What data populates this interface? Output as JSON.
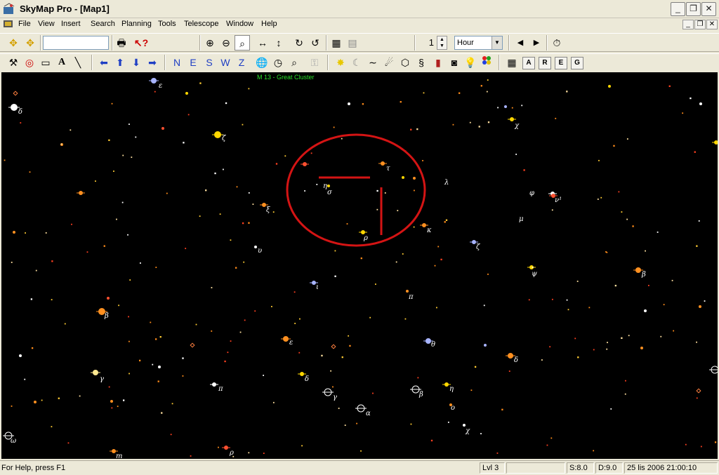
{
  "window": {
    "title": "SkyMap Pro - [Map1]",
    "controls": [
      "_",
      "❐",
      "✕"
    ]
  },
  "menu": [
    "File",
    "View",
    "Insert",
    "Search",
    "Planning",
    "Tools",
    "Telescope",
    "Window",
    "Help"
  ],
  "mdi_controls": [
    "_",
    "❐",
    "✕"
  ],
  "toolbar": {
    "search_value": "",
    "step_value": "1",
    "unit_select": "Hour",
    "direction_labels": [
      "N",
      "E",
      "S",
      "W",
      "Z"
    ],
    "grid_buttons": [
      "A",
      "R",
      "E",
      "G"
    ]
  },
  "map": {
    "object_label": "M 13 - Great Cluster",
    "colors": {
      "background": "#000000",
      "circle": "#d41414",
      "label": "#28e028"
    },
    "star_labels": [
      {
        "text": "ε"
      },
      {
        "text": "δ"
      },
      {
        "text": "ζ"
      },
      {
        "text": "χ"
      },
      {
        "text": "τ"
      },
      {
        "text": "η"
      },
      {
        "text": "σ"
      },
      {
        "text": "λ"
      },
      {
        "text": "φ"
      },
      {
        "text": "ν¹"
      },
      {
        "text": "ξ"
      },
      {
        "text": "μ"
      },
      {
        "text": "κ"
      },
      {
        "text": "ρ"
      },
      {
        "text": "υ"
      },
      {
        "text": "ζ"
      },
      {
        "text": "ψ"
      },
      {
        "text": "β"
      },
      {
        "text": "ι"
      },
      {
        "text": "π"
      },
      {
        "text": "β"
      },
      {
        "text": "ε"
      },
      {
        "text": "θ"
      },
      {
        "text": "δ"
      },
      {
        "text": "γ"
      },
      {
        "text": "δ"
      },
      {
        "text": "γ"
      },
      {
        "text": "π"
      },
      {
        "text": "β"
      },
      {
        "text": "η"
      },
      {
        "text": "ο"
      },
      {
        "text": "α"
      },
      {
        "text": "χ"
      },
      {
        "text": "ω"
      },
      {
        "text": "ρ"
      },
      {
        "text": "m"
      }
    ]
  },
  "status": {
    "help": "For Help, press F1",
    "level": "Lvl 3",
    "blank": "",
    "s_value": "S:8.0",
    "d_value": "D:9.0",
    "datetime": "25 lis 2006 21:00:10"
  }
}
